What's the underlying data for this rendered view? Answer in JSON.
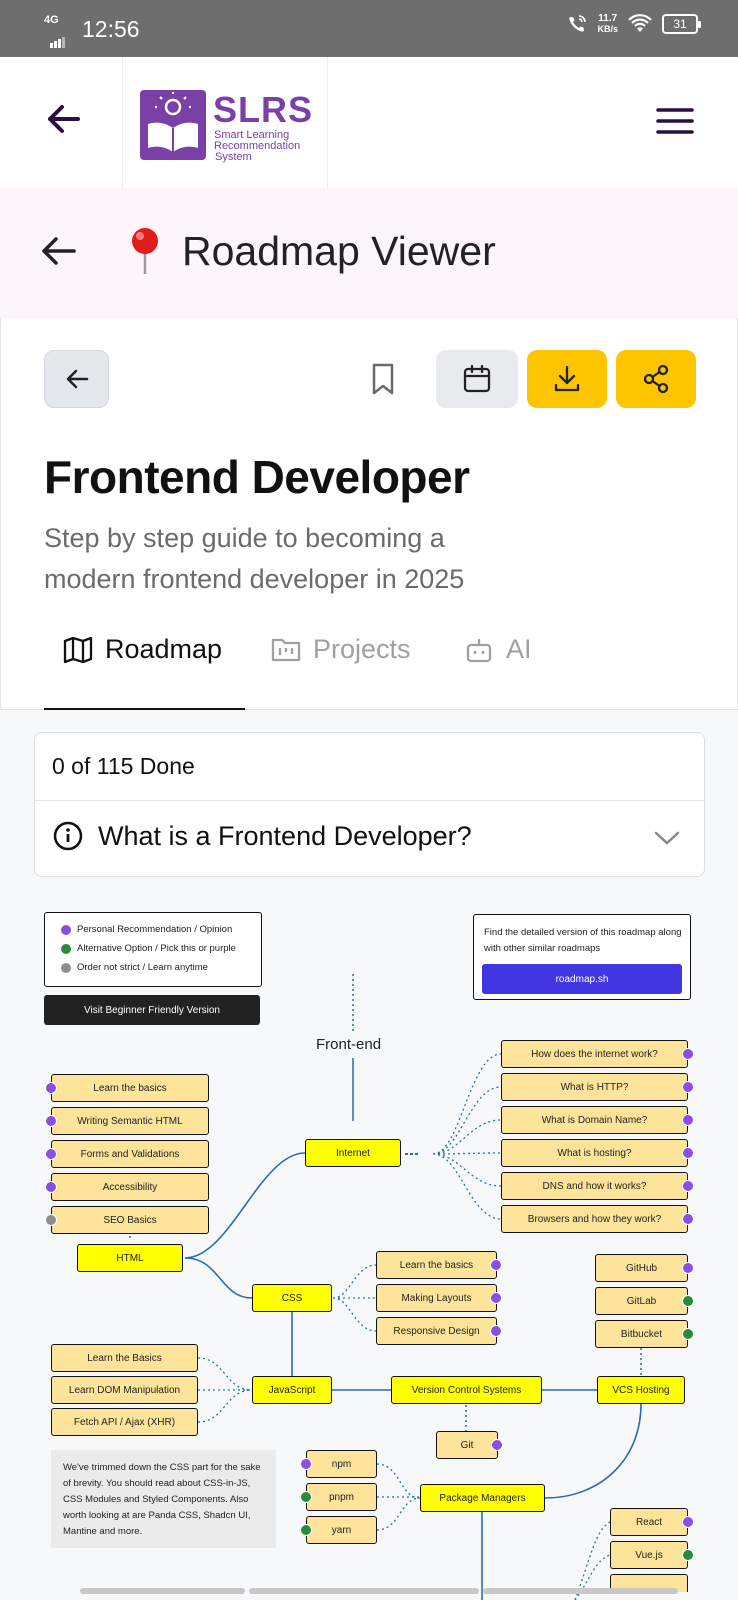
{
  "status_bar": {
    "network": "4G",
    "time": "12:56",
    "speed_value": "11.7",
    "speed_unit": "KB/s",
    "battery": "31"
  },
  "app_header": {
    "logo_title": "SLRS",
    "logo_subtitle_1": "Smart Learning",
    "logo_subtitle_2": "Recommendation",
    "logo_subtitle_3": "System"
  },
  "viewer_bar": {
    "title": "Roadmap Viewer"
  },
  "roadmap": {
    "title": "Frontend Developer",
    "description": "Step by step guide to becoming a modern frontend developer in 2025"
  },
  "tabs": [
    {
      "label": "Roadmap",
      "active": true
    },
    {
      "label": "Projects",
      "active": false
    },
    {
      "label": "AI",
      "active": false
    }
  ],
  "progress": {
    "done_text": "0 of 115 Done",
    "faq_question": "What is a Frontend Developer?"
  },
  "diagram": {
    "legend": [
      {
        "label": "Personal Recommendation / Opinion",
        "color": "#8a4fe0"
      },
      {
        "label": "Alternative Option / Pick this or purple",
        "color": "#2d8a3a"
      },
      {
        "label": "Order not strict / Learn anytime",
        "color": "#8e8e8e"
      }
    ],
    "beginner_button": "Visit Beginner Friendly Version",
    "promo_text": "Find the detailed version of this roadmap along with other similar roadmaps",
    "promo_button": "roadmap.sh",
    "root_label": "Front-end",
    "internet_topics": [
      "How does the internet work?",
      "What is HTTP?",
      "What is Domain Name?",
      "What is hosting?",
      "DNS and how it works?",
      "Browsers and how they work?"
    ],
    "html_topics": [
      "Learn the basics",
      "Writing Semantic HTML",
      "Forms and Validations",
      "Accessibility",
      "SEO Basics"
    ],
    "css_topics": [
      "Learn the basics",
      "Making Layouts",
      "Responsive Design"
    ],
    "js_topics": [
      "Learn the Basics",
      "Learn DOM Manipulation",
      "Fetch API / Ajax (XHR)"
    ],
    "vcs_hosting": [
      "GitHub",
      "GitLab",
      "Bitbucket"
    ],
    "package_managers_list": [
      "npm",
      "pnpm",
      "yarn"
    ],
    "frameworks": [
      "React",
      "Vue.js"
    ],
    "main_nodes": {
      "internet": "Internet",
      "html": "HTML",
      "css": "CSS",
      "javascript": "JavaScript",
      "vcs": "Version Control Systems",
      "vcs_hosting": "VCS Hosting",
      "git": "Git",
      "package_managers": "Package Managers"
    },
    "note": "We've trimmed down the CSS part for the sake of brevity. You should read about CSS-in-JS, CSS Modules and Styled Components. Also worth looking at are Panda CSS, Shadcn UI, Mantine and more."
  },
  "colors": {
    "brand": "#7b3fa8",
    "accent": "#fdc400",
    "topic_fill": "#fde49a",
    "main_node_fill": "#ffff00",
    "promo_blue": "#4136e2"
  }
}
